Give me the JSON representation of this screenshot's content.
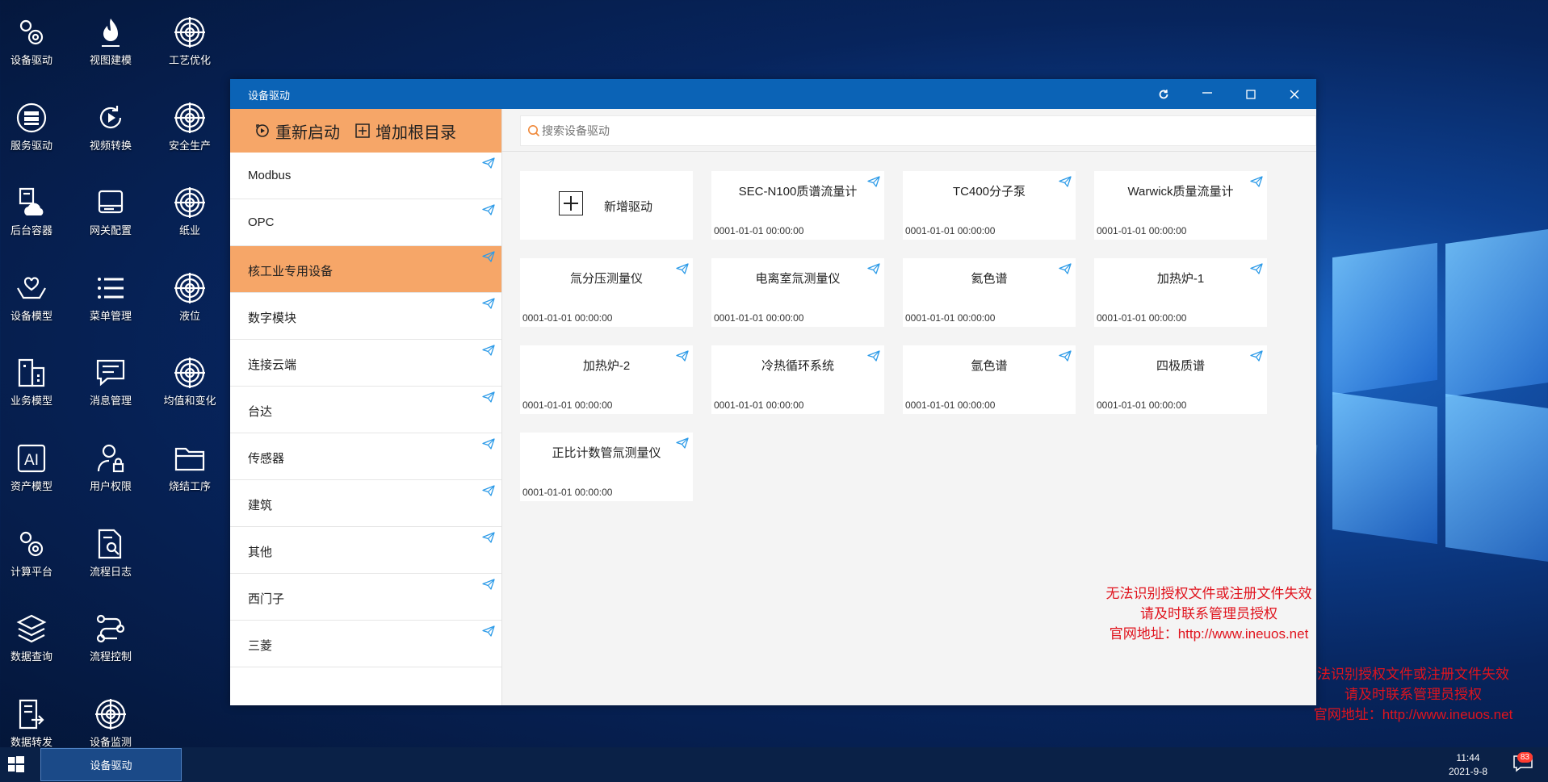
{
  "desktop_icons": [
    {
      "label": "设备驱动",
      "icon": "gears-icon"
    },
    {
      "label": "视图建模",
      "icon": "flame-icon"
    },
    {
      "label": "工艺优化",
      "icon": "target-icon"
    },
    {
      "label": "服务驱动",
      "icon": "server-icon"
    },
    {
      "label": "视频转换",
      "icon": "video-convert-icon"
    },
    {
      "label": "安全生产",
      "icon": "target-icon"
    },
    {
      "label": "后台容器",
      "icon": "cloud-doc-icon"
    },
    {
      "label": "网关配置",
      "icon": "drive-icon"
    },
    {
      "label": "纸业",
      "icon": "target-icon"
    },
    {
      "label": "设备模型",
      "icon": "hands-icon"
    },
    {
      "label": "菜单管理",
      "icon": "list-icon"
    },
    {
      "label": "液位",
      "icon": "target-icon"
    },
    {
      "label": "业务模型",
      "icon": "building-icon"
    },
    {
      "label": "消息管理",
      "icon": "message-icon"
    },
    {
      "label": "均值和变化",
      "icon": "target-icon"
    },
    {
      "label": "资产模型",
      "icon": "ai-icon"
    },
    {
      "label": "用户权限",
      "icon": "user-lock-icon"
    },
    {
      "label": "烧结工序",
      "icon": "folder-icon"
    },
    {
      "label": "计算平台",
      "icon": "gears-icon"
    },
    {
      "label": "流程日志",
      "icon": "doc-search-icon"
    },
    {
      "label": "数据查询",
      "icon": "layers-icon"
    },
    {
      "label": "流程控制",
      "icon": "flow-icon"
    },
    {
      "label": "数据转发",
      "icon": "doc-forward-icon"
    },
    {
      "label": "设备监测",
      "icon": "target-icon"
    }
  ],
  "window": {
    "title": "设备驱动",
    "controls": [
      "refresh-icon",
      "minimize-icon",
      "maximize-icon",
      "close-icon"
    ]
  },
  "sidebar": {
    "restart_label": "重新启动",
    "add_root_label": "增加根目录",
    "items": [
      {
        "label": "Modbus",
        "active": false
      },
      {
        "label": "OPC",
        "active": false
      },
      {
        "label": "核工业专用设备",
        "active": true
      },
      {
        "label": "数字模块",
        "active": false
      },
      {
        "label": "连接云端",
        "active": false
      },
      {
        "label": "台达",
        "active": false
      },
      {
        "label": "传感器",
        "active": false
      },
      {
        "label": "建筑",
        "active": false
      },
      {
        "label": "其他",
        "active": false
      },
      {
        "label": "西门子",
        "active": false
      },
      {
        "label": "三菱",
        "active": false
      }
    ]
  },
  "search": {
    "placeholder": "搜索设备驱动"
  },
  "add_driver_label": "新增驱动",
  "cards": [
    {
      "name": "SEC-N100质谱流量计",
      "date": "0001-01-01 00:00:00"
    },
    {
      "name": "TC400分子泵",
      "date": "0001-01-01 00:00:00"
    },
    {
      "name": "Warwick质量流量计",
      "date": "0001-01-01 00:00:00"
    },
    {
      "name": "氚分压测量仪",
      "date": "0001-01-01 00:00:00"
    },
    {
      "name": "电离室氚测量仪",
      "date": "0001-01-01 00:00:00"
    },
    {
      "name": "氦色谱",
      "date": "0001-01-01 00:00:00"
    },
    {
      "name": "加热炉-1",
      "date": "0001-01-01 00:00:00"
    },
    {
      "name": "加热炉-2",
      "date": "0001-01-01 00:00:00"
    },
    {
      "name": "冷热循环系统",
      "date": "0001-01-01 00:00:00"
    },
    {
      "name": "氩色谱",
      "date": "0001-01-01 00:00:00"
    },
    {
      "name": "四极质谱",
      "date": "0001-01-01 00:00:00"
    },
    {
      "name": "正比计数管氚测量仪",
      "date": "0001-01-01 00:00:00"
    }
  ],
  "warning_window": {
    "line1": "无法识别授权文件或注册文件失效",
    "line2": "请及时联系管理员授权",
    "line3": "官网地址：http://www.ineuos.net"
  },
  "warning_desktop": {
    "line1": "法识别授权文件或注册文件失效",
    "line2": "请及时联系管理员授权",
    "line3": "官网地址：http://www.ineuos.net"
  },
  "taskbar": {
    "task_label": "设备驱动",
    "time": "11:44",
    "date": "2021-9-8",
    "notification_count": "83"
  },
  "colors": {
    "titlebar": "#0b63b6",
    "accent": "#f6a668",
    "warning": "#e0141e",
    "send_icon": "#2d9be8"
  }
}
